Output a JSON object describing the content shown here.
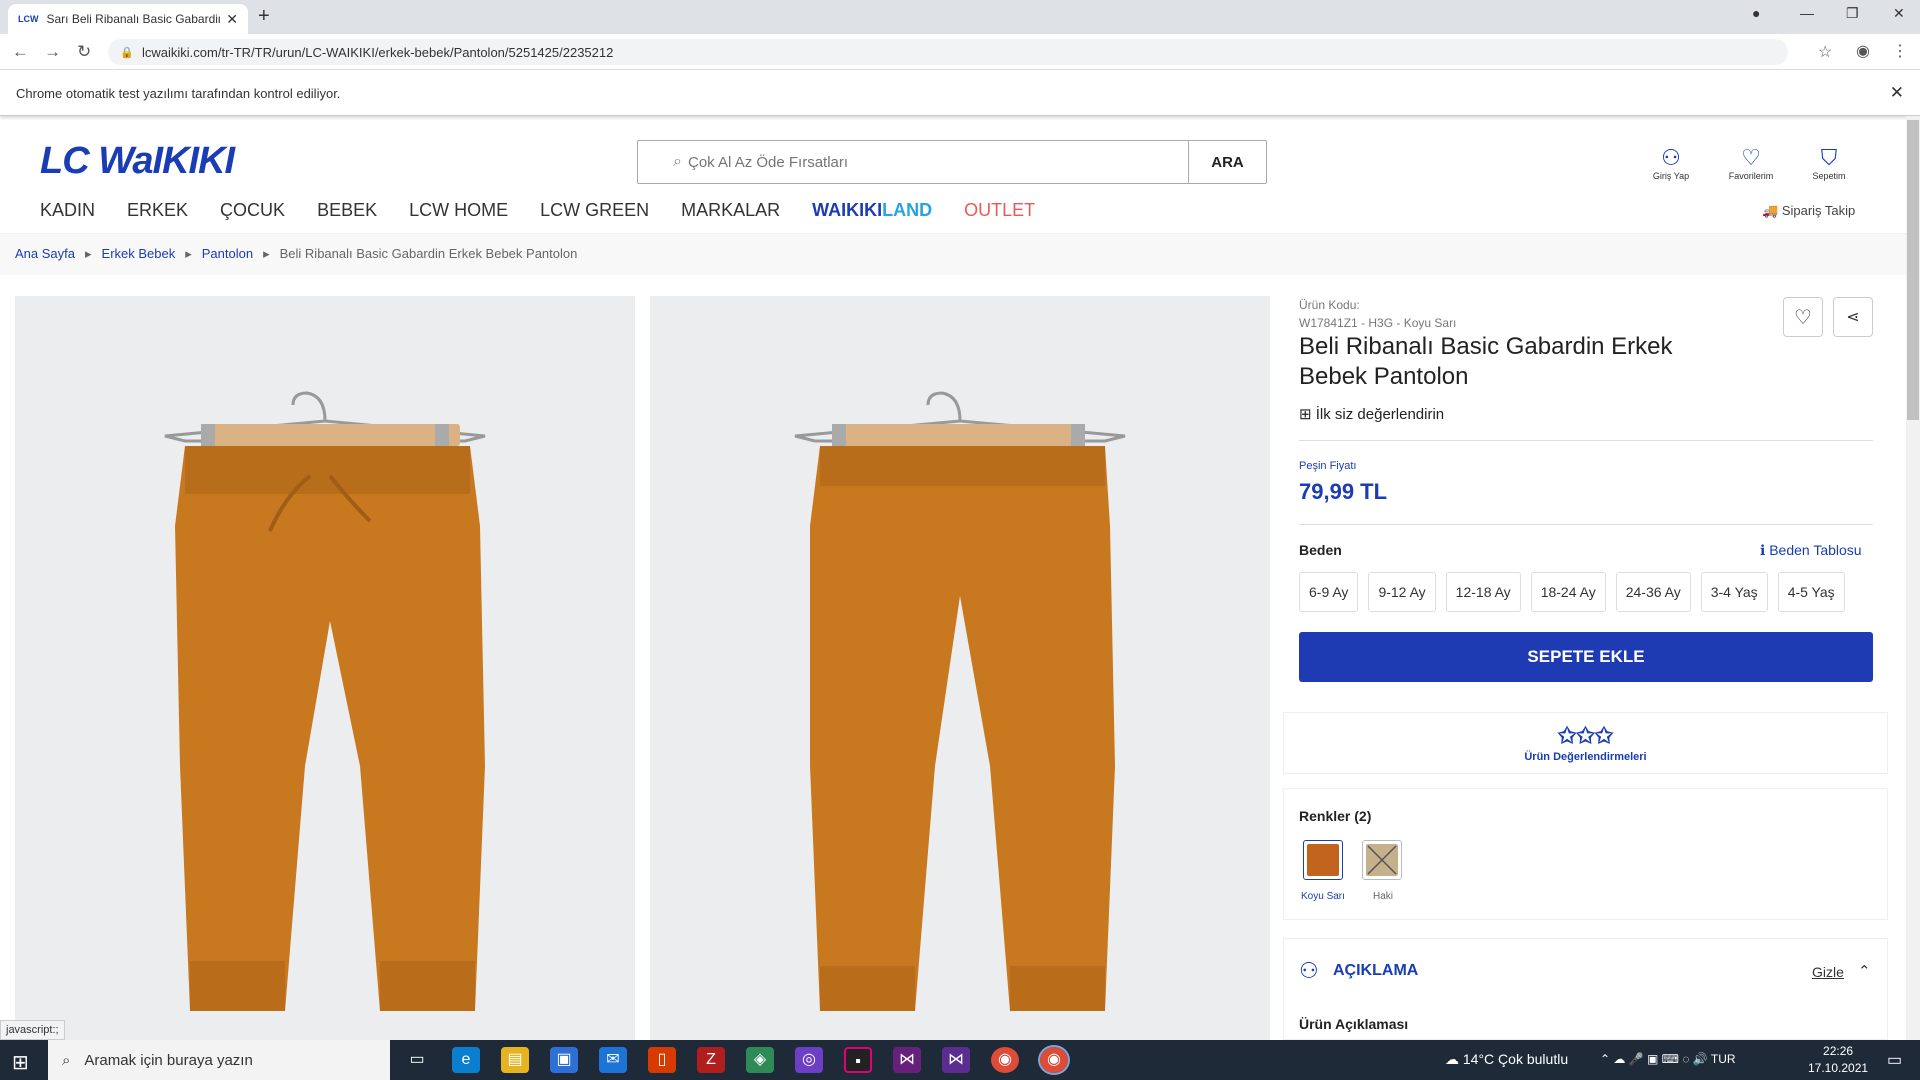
{
  "browser": {
    "tab_title": "Sarı Beli Ribanalı Basic Gabardin E",
    "tab_favicon": "LCW",
    "url": "lcwaikiki.com/tr-TR/TR/urun/LC-WAIKIKI/erkek-bebek/Pantolon/5251425/2235212",
    "infobar": "Chrome otomatik test yazılımı tarafından kontrol ediliyor.",
    "status": "javascript:;"
  },
  "site": {
    "logo": "LC WaIKIKI",
    "search_placeholder": "Çok Al Az Öde Fırsatları",
    "search_button": "ARA",
    "header_icons": [
      {
        "label": "Giriş Yap",
        "icon": "user-icon"
      },
      {
        "label": "Favorilerim",
        "icon": "heart-icon"
      },
      {
        "label": "Sepetim",
        "icon": "bag-icon"
      }
    ],
    "nav": [
      "KADIN",
      "ERKEK",
      "ÇOCUK",
      "BEBEK",
      "LCW HOME",
      "LCW GREEN",
      "MARKALAR"
    ],
    "nav_waiki": "WAIKIKI",
    "nav_land": "LAND",
    "nav_outlet": "OUTLET",
    "order_track": "Sipariş Takip",
    "breadcrumb": [
      "Ana Sayfa",
      "Erkek Bebek",
      "Pantolon",
      "Beli Ribanalı Basic Gabardin Erkek Bebek Pantolon"
    ]
  },
  "product": {
    "code_label": "Ürün Kodu:",
    "code": "W17841Z1 - H3G - Koyu Sarı",
    "title": "Beli Ribanalı Basic Gabardin Erkek Bebek Pantolon",
    "review_link": "İlk siz değerlendirin",
    "price_label": "Peşin Fiyatı",
    "price": "79,99 TL",
    "size_label": "Beden",
    "size_table": "Beden Tablosu",
    "sizes": [
      "6-9 Ay",
      "9-12 Ay",
      "12-18 Ay",
      "18-24 Ay",
      "24-36 Ay",
      "3-4 Yaş",
      "4-5 Yaş"
    ],
    "add_to_cart": "SEPETE EKLE",
    "ratings_label": "Ürün Değerlendirmeleri",
    "colors_label": "Renkler (2)",
    "colors": [
      {
        "name": "Koyu Sarı",
        "hex": "#c0641e"
      },
      {
        "name": "Haki",
        "hex": "#c4b08c"
      }
    ],
    "description_header": "AÇIKLAMA",
    "hide": "Gizle",
    "description_label": "Ürün Açıklaması",
    "pants_color": "#c8791f"
  },
  "taskbar": {
    "search": "Aramak için buraya yazın",
    "weather": "14°C  Çok bulutlu",
    "lang": "TUR",
    "time": "22:26",
    "date": "17.10.2021"
  }
}
